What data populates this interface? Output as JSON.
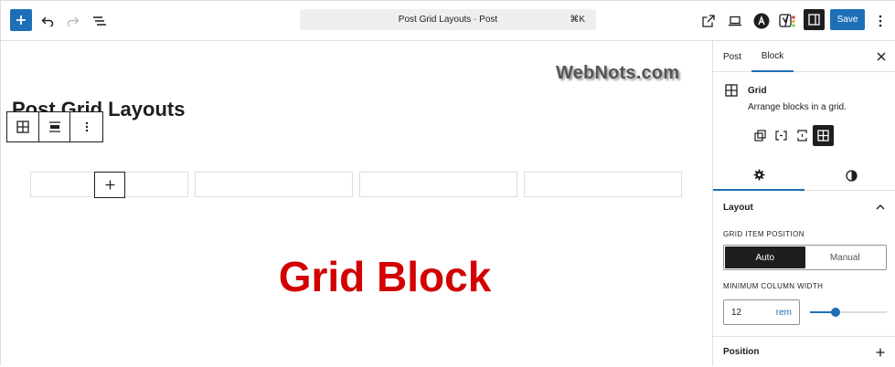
{
  "toolbar": {
    "document_title": "Post Grid Layouts · Post",
    "shortcut": "⌘K",
    "save_label": "Save"
  },
  "canvas": {
    "watermark": "WebNots.com",
    "post_title": "Post Grid Layouts",
    "headline": "Grid Block",
    "grid_cells": 4
  },
  "sidebar": {
    "tabs": [
      "Post",
      "Block"
    ],
    "active_tab": "Block",
    "block_name": "Grid",
    "block_description": "Arrange blocks in a grid.",
    "layout_title": "Layout",
    "grid_item_position_label": "GRID ITEM POSITION",
    "position_options": [
      "Auto",
      "Manual"
    ],
    "position_selected": "Auto",
    "min_col_width_label": "MINIMUM COLUMN WIDTH",
    "min_col_width_value": "12",
    "min_col_width_unit": "rem",
    "min_col_width_slider_fraction": 0.31,
    "position_title": "Position"
  },
  "colors": {
    "accent": "#1e6fb8",
    "headline": "#d20000",
    "dark": "#1e1e1e"
  }
}
